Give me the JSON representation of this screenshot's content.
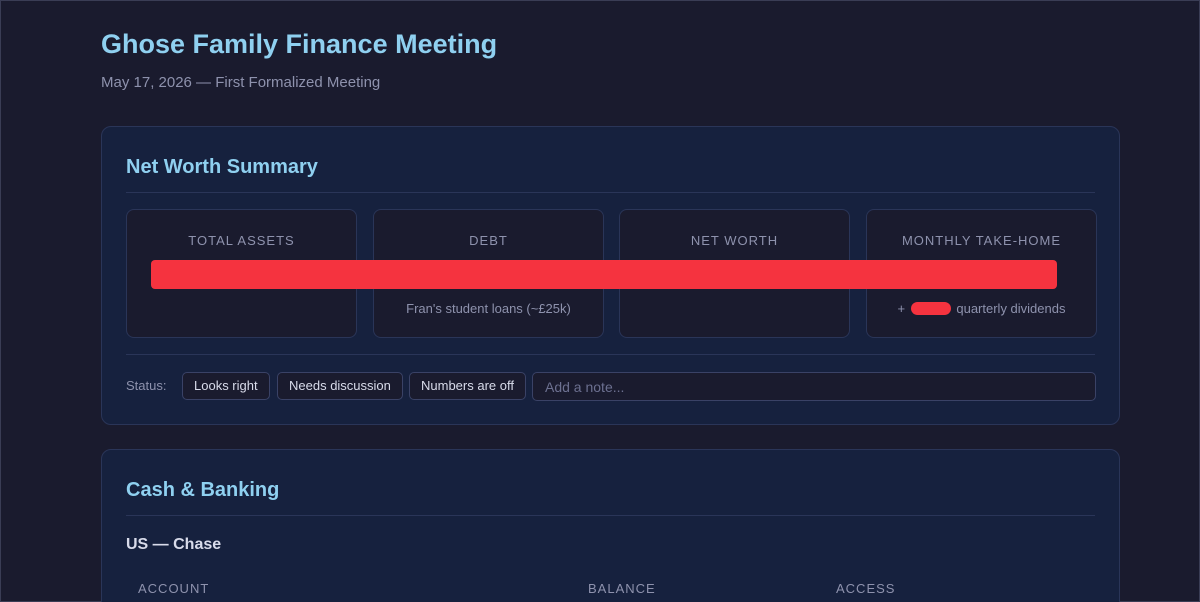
{
  "header": {
    "title": "Ghose Family Finance Meeting",
    "subtitle": "May 17, 2026 — First Formalized Meeting"
  },
  "net_worth": {
    "title": "Net Worth Summary",
    "metrics": [
      {
        "label": "TOTAL ASSETS",
        "note": ""
      },
      {
        "label": "DEBT",
        "note": "Fran's student loans (~£25k)"
      },
      {
        "label": "NET WORTH",
        "note": ""
      },
      {
        "label": "MONTHLY TAKE-HOME",
        "note_prefix": "+",
        "note_suffix": "quarterly dividends"
      }
    ],
    "status": {
      "label": "Status:",
      "buttons": [
        "Looks right",
        "Needs discussion",
        "Numbers are off"
      ],
      "note_placeholder": "Add a note..."
    }
  },
  "cash_banking": {
    "title": "Cash & Banking",
    "subsection": "US — Chase",
    "columns": [
      "ACCOUNT",
      "BALANCE",
      "ACCESS"
    ]
  },
  "colors": {
    "accent": "#8fd0f0",
    "background": "#1a1b2e",
    "card": "#16213e",
    "redaction": "#f5333f"
  }
}
